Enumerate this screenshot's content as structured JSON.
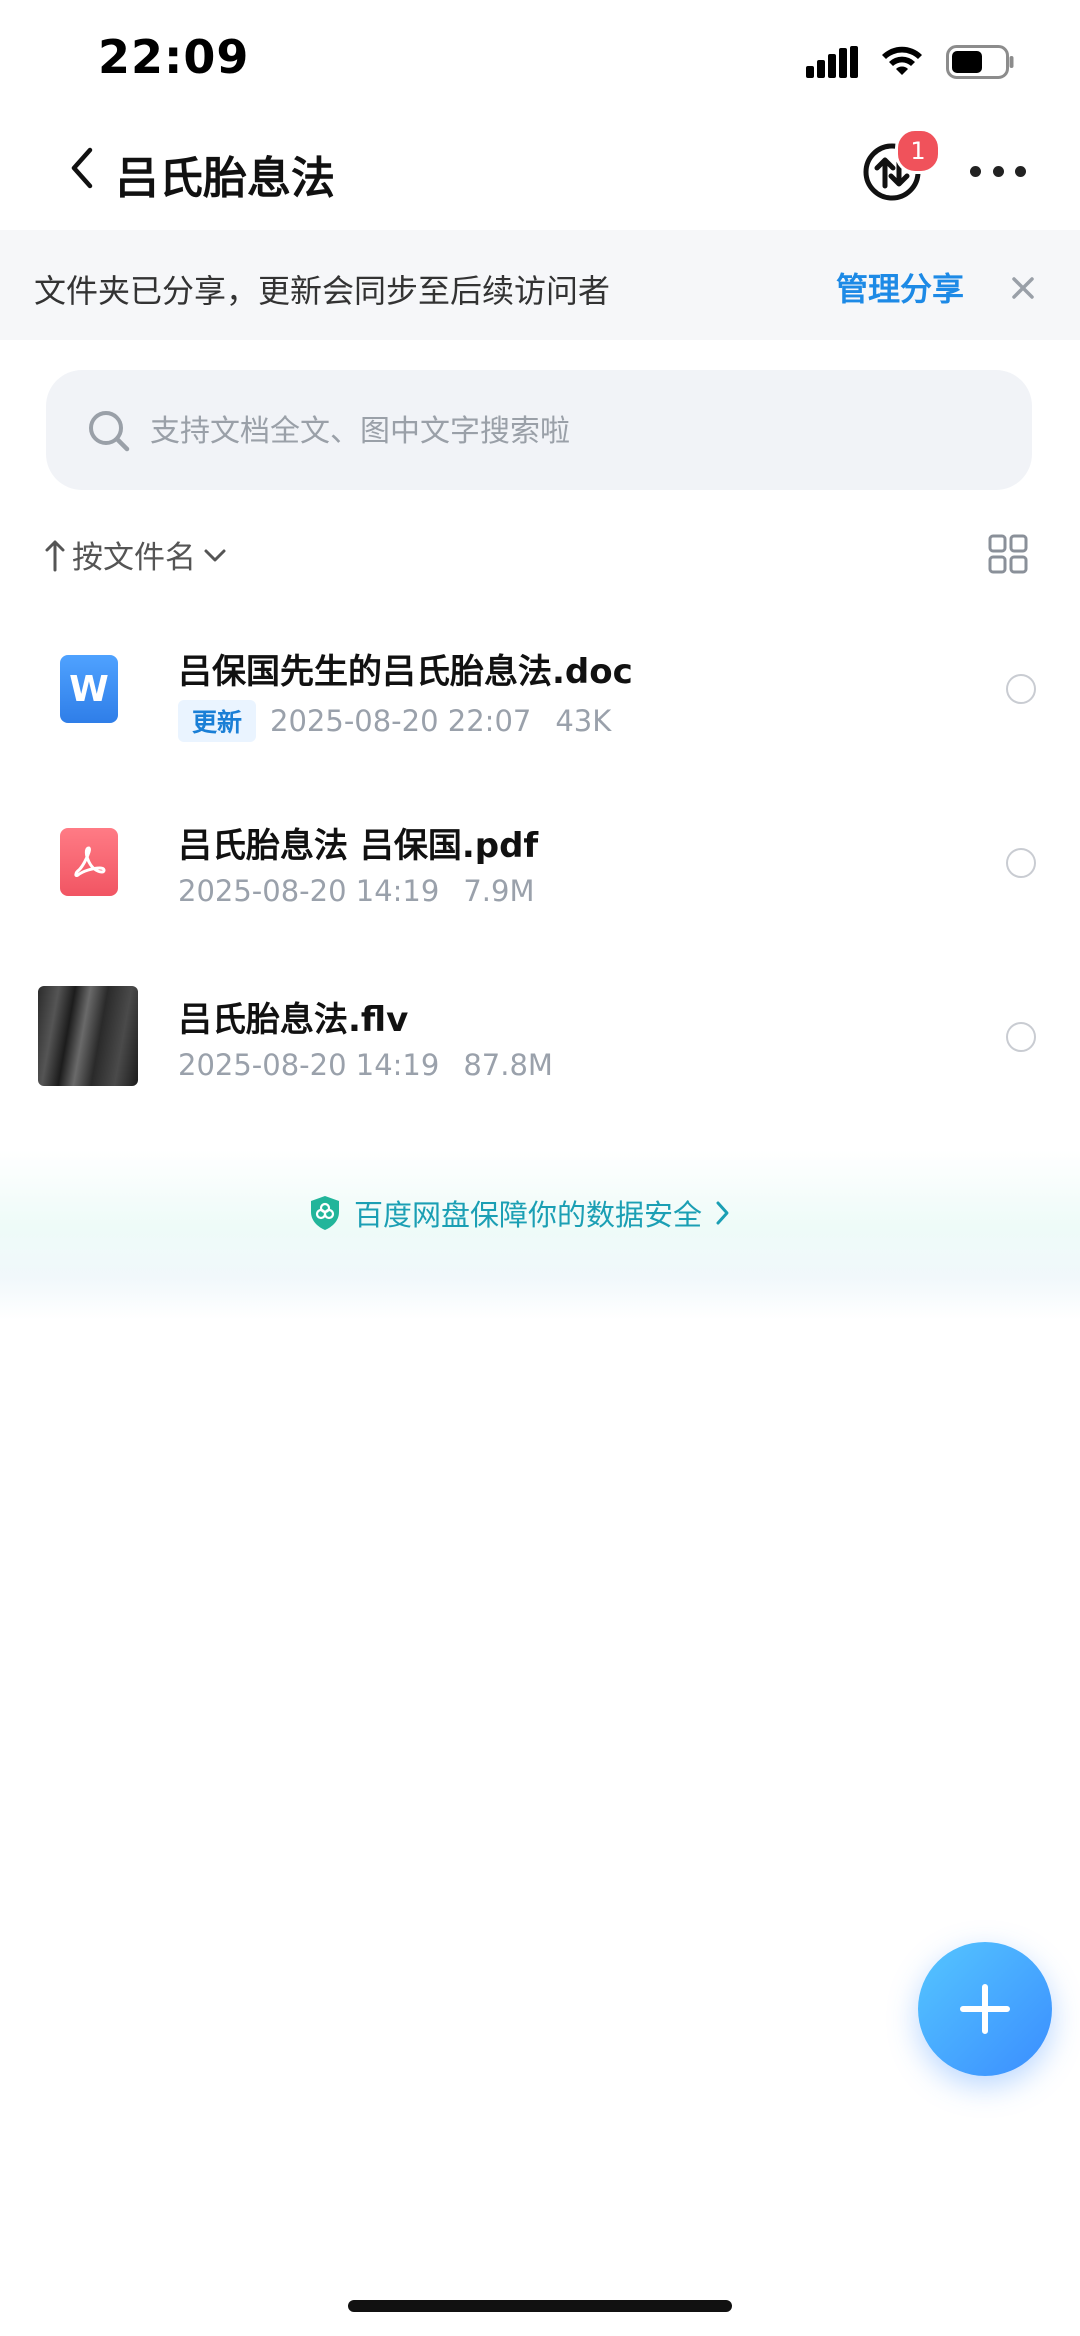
{
  "status_bar": {
    "time": "22:09"
  },
  "nav": {
    "title": "吕氏胎息法",
    "transfer_badge": "1"
  },
  "banner": {
    "text": "文件夹已分享，更新会同步至后续访问者",
    "link": "管理分享"
  },
  "search": {
    "placeholder": "支持文档全文、图中文字搜索啦"
  },
  "sort": {
    "label": "按文件名"
  },
  "files": [
    {
      "name": "吕保国先生的吕氏胎息法.doc",
      "tag": "更新",
      "date": "2025-08-20 22:07",
      "size": "43K",
      "icon": "word-doc-icon",
      "icon_letter": "W"
    },
    {
      "name": "吕氏胎息法 吕保国.pdf",
      "date": "2025-08-20 14:19",
      "size": "7.9M",
      "icon": "pdf-icon"
    },
    {
      "name": "吕氏胎息法.flv",
      "date": "2025-08-20 14:19",
      "size": "87.8M",
      "icon": "video-thumbnail"
    }
  ],
  "footer": {
    "security_text": "百度网盘保障你的数据安全"
  },
  "colors": {
    "accent": "#1d8ae6",
    "badge": "#f0525b",
    "secure": "#1b9fb4",
    "fab": "#3a8dff"
  }
}
